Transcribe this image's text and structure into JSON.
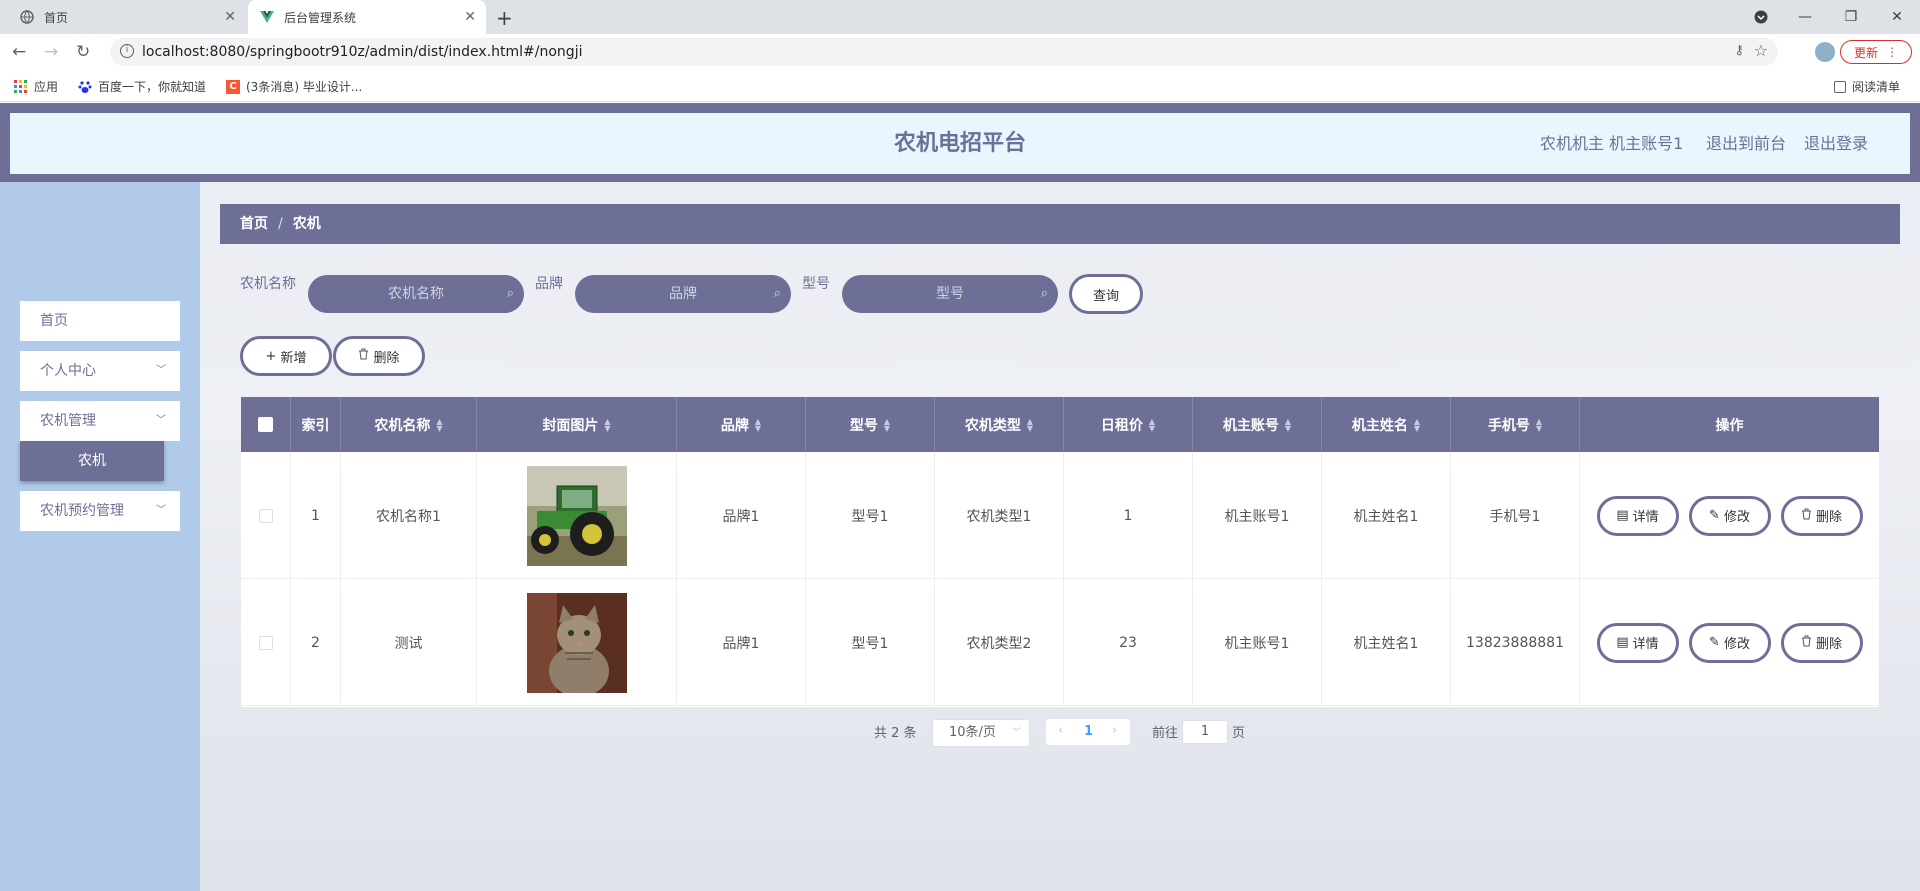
{
  "browser": {
    "tabs": [
      {
        "title": "首页",
        "active": false
      },
      {
        "title": "后台管理系统",
        "active": true
      }
    ],
    "url": "localhost:8080/springbootr910z/admin/dist/index.html#/nongji",
    "update_label": "更新",
    "bookmarks": [
      "应用",
      "百度一下，你就知道",
      "(3条消息) 毕业设计...",
      "阅读清单"
    ]
  },
  "header": {
    "title": "农机电招平台",
    "user": "农机机主 机主账号1",
    "to_front": "退出到前台",
    "logout": "退出登录"
  },
  "sidebar": {
    "items": [
      {
        "label": "首页",
        "has_children": false
      },
      {
        "label": "个人中心",
        "has_children": true
      },
      {
        "label": "农机管理",
        "has_children": true,
        "children": [
          "农机"
        ]
      },
      {
        "label": "农机预约管理",
        "has_children": true
      }
    ]
  },
  "breadcrumb": [
    "首页",
    "农机"
  ],
  "search": {
    "fields": [
      {
        "label": "农机名称",
        "placeholder": "农机名称"
      },
      {
        "label": "品牌",
        "placeholder": "品牌"
      },
      {
        "label": "型号",
        "placeholder": "型号"
      }
    ],
    "query_label": "查询"
  },
  "actions": {
    "add_label": "新增",
    "delete_label": "删除"
  },
  "table": {
    "columns": [
      "索引",
      "农机名称",
      "封面图片",
      "品牌",
      "型号",
      "农机类型",
      "日租价",
      "机主账号",
      "机主姓名",
      "手机号",
      "操作"
    ],
    "rows": [
      {
        "index": "1",
        "name": "农机名称1",
        "image": "tractor",
        "brand": "品牌1",
        "model": "型号1",
        "type": "农机类型1",
        "price": "1",
        "owner_account": "机主账号1",
        "owner_name": "机主姓名1",
        "phone": "手机号1"
      },
      {
        "index": "2",
        "name": "测试",
        "image": "cat",
        "brand": "品牌1",
        "model": "型号1",
        "type": "农机类型2",
        "price": "23",
        "owner_account": "机主账号1",
        "owner_name": "机主姓名1",
        "phone": "13823888881"
      }
    ],
    "row_actions": {
      "detail": "详情",
      "edit": "修改",
      "delete": "删除"
    }
  },
  "pagination": {
    "total": "共 2 条",
    "page_size": "10条/页",
    "current_page": "1",
    "goto_label": "前往",
    "goto_value": "1",
    "page_suffix": "页"
  },
  "colors": {
    "primary": "#6e6f97",
    "sidebar": "#b1cae9",
    "header_bg": "#e8f6fd"
  }
}
